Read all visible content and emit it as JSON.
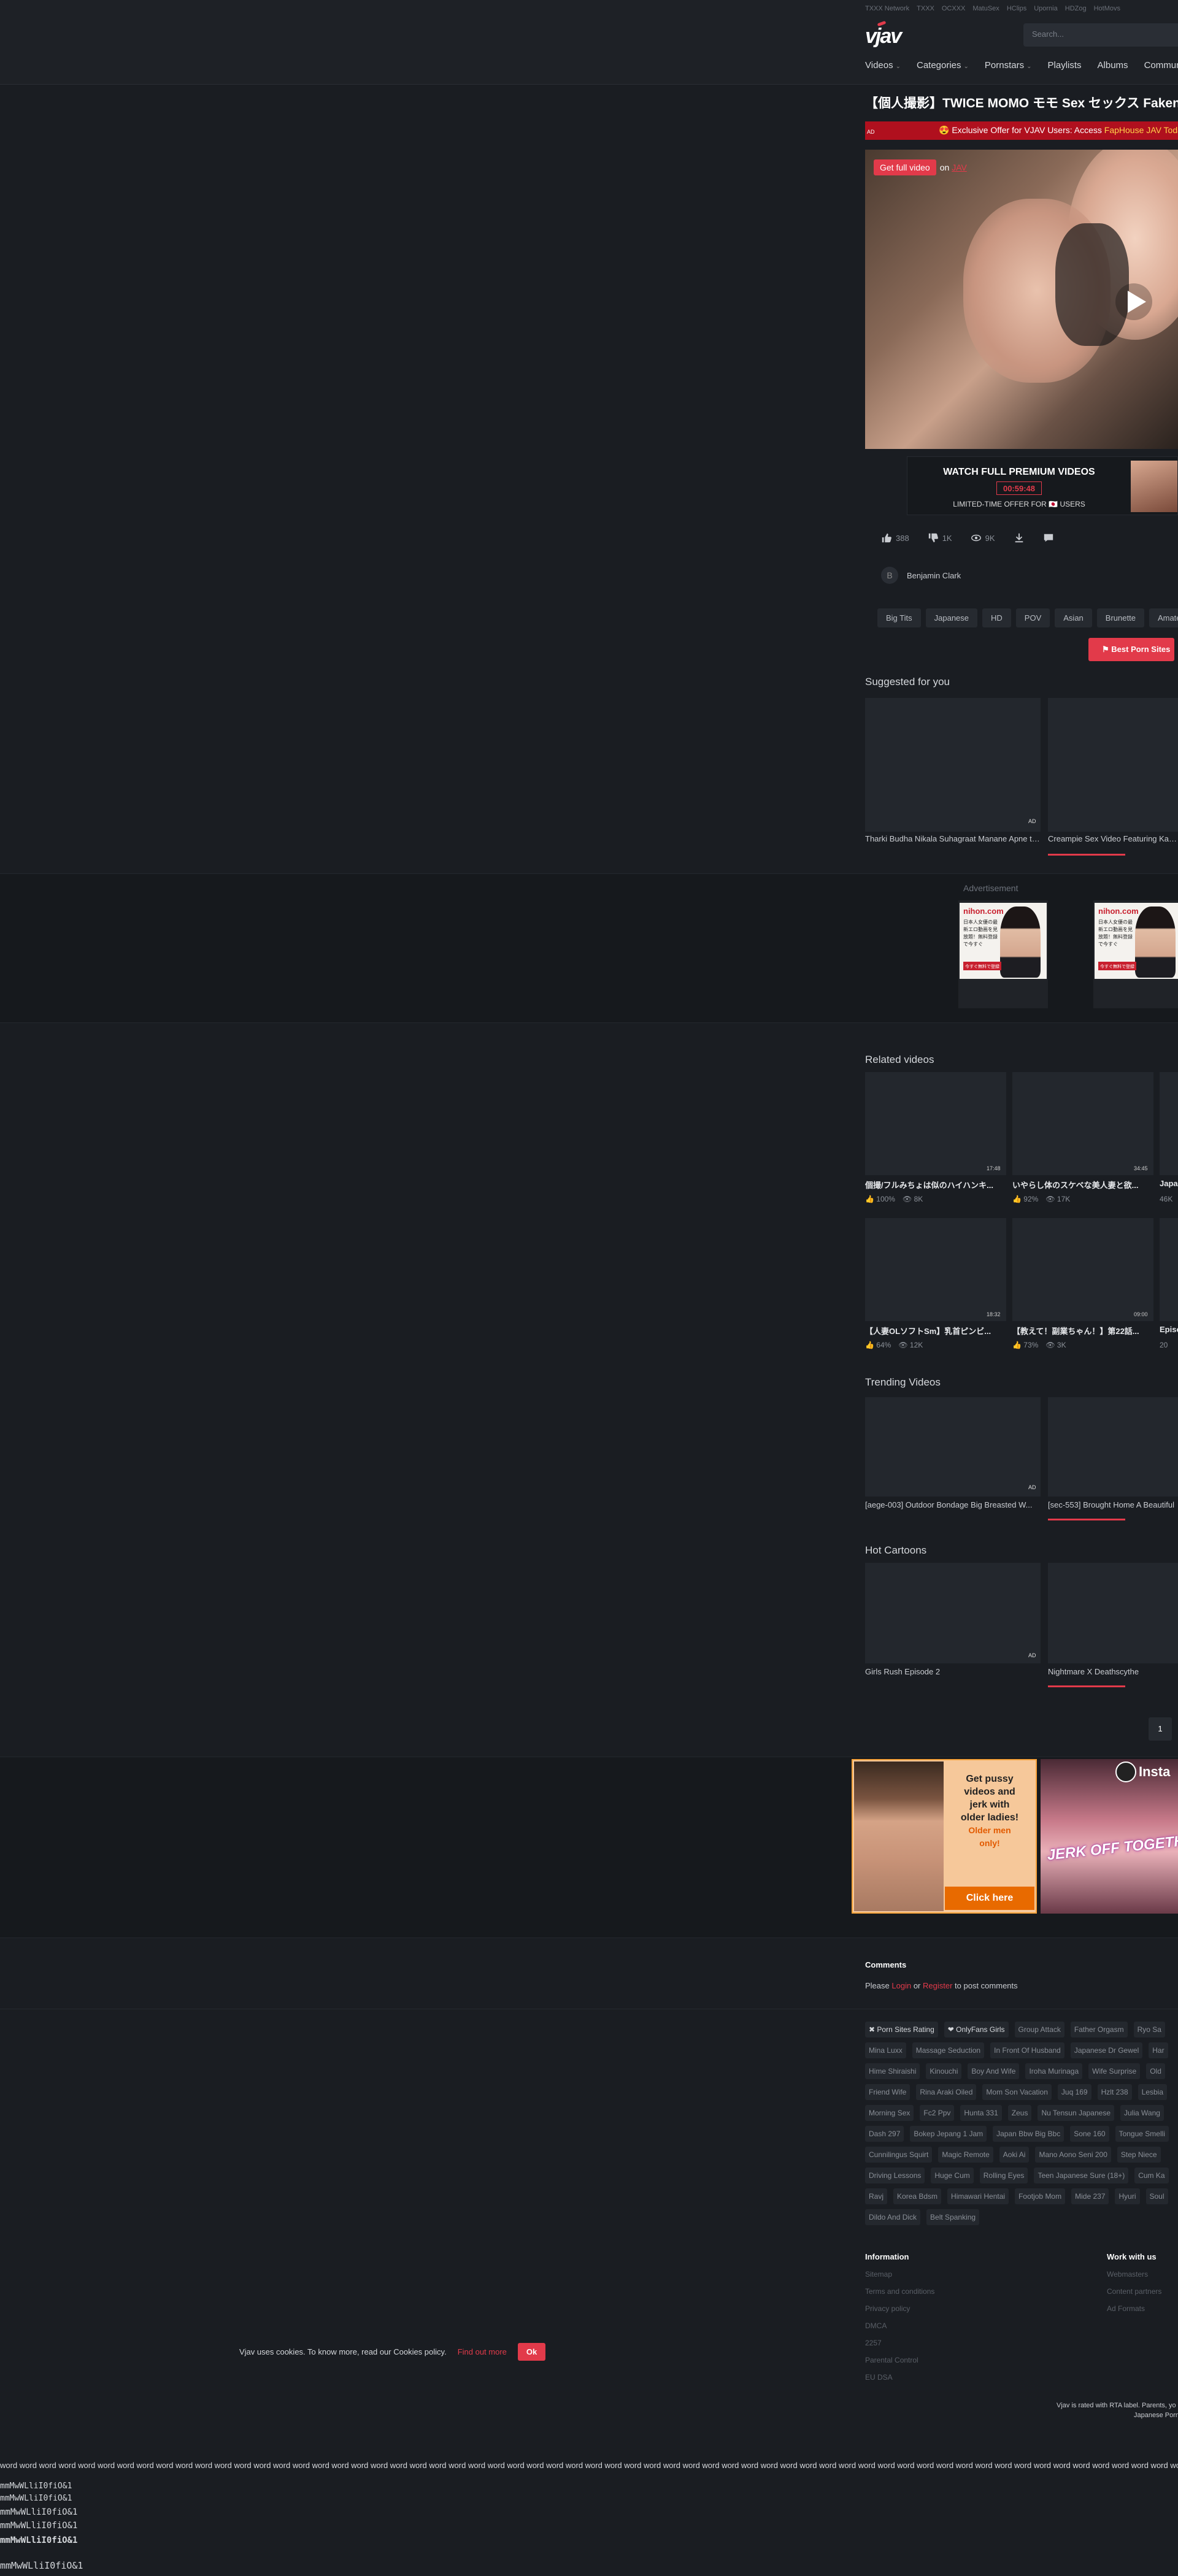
{
  "header": {
    "network_label": "TXXX Network",
    "network_links": [
      "TXXX",
      "OCXXX",
      "MatuSex",
      "HClips",
      "Upornia",
      "HDZog",
      "HotMovs"
    ],
    "logo": "vjav",
    "search_placeholder": "Search...",
    "nav": [
      {
        "label": "Videos",
        "has_dropdown": true
      },
      {
        "label": "Categories",
        "has_dropdown": true
      },
      {
        "label": "Pornstars",
        "has_dropdown": true
      },
      {
        "label": "Playlists",
        "has_dropdown": false
      },
      {
        "label": "Albums",
        "has_dropdown": false
      },
      {
        "label": "Community",
        "has_dropdown": false
      }
    ]
  },
  "video": {
    "title": "【個人撮影】TWICE MOMO モモ Sex セックス Fakenude",
    "ad_label": "AD",
    "offer_text": "😍 Exclusive Offer for VJAV Users: Access ",
    "offer_highlight": "FapHouse JAV Today",
    "get_full_label": "Get full video",
    "get_full_on": "on",
    "get_full_site": "JAV"
  },
  "premium": {
    "headline": "WATCH FULL PREMIUM VIDEOS",
    "timer": "00:59:48",
    "subline": "LIMITED-TIME OFFER FOR 🇯🇵 USERS"
  },
  "stats": {
    "likes": "388",
    "dislikes": "1K",
    "views": "9K"
  },
  "author": {
    "initial": "B",
    "name": "Benjamin Clark"
  },
  "tags": [
    "Big Tits",
    "Japanese",
    "HD",
    "POV",
    "Asian",
    "Brunette",
    "Amateur"
  ],
  "best_sites_button": "Best Porn Sites",
  "suggested": {
    "heading": "Suggested for you",
    "items": [
      {
        "title": "Tharki Budha Nikala Suhagraat Manane Apne te...",
        "badge": "AD"
      },
      {
        "title": "Creampie Sex Video Featuring Kanna"
      }
    ]
  },
  "advertisement_label": "Advertisement",
  "ad_creative": {
    "brand": "nihon.com",
    "text": "日本人女優の最新エロ動画を見放題！無料登録で今すぐ",
    "button": "今すぐ無料で登録"
  },
  "related": {
    "heading": "Related videos",
    "rows": [
      [
        {
          "title": "個撮/フルみちょは似のハイハンキ...",
          "duration": "17:48",
          "rating": "100%",
          "views": "8K"
        },
        {
          "title": "いやらし体のスケベな美人妻と欲...",
          "duration": "34:45",
          "rating": "92%",
          "views": "17K"
        },
        {
          "title": "Japanese",
          "duration": "",
          "rating": "",
          "views": "46K"
        }
      ],
      [
        {
          "title": "【人妻OLソフトSm】乳首ピンビ...",
          "duration": "18:32",
          "rating": "64%",
          "views": "12K"
        },
        {
          "title": "【教えて！副業ちゃん！】第22話...",
          "duration": "09:00",
          "rating": "73%",
          "views": "3K"
        },
        {
          "title": "Episode",
          "duration": "",
          "rating": "",
          "views": "20"
        }
      ]
    ]
  },
  "trending": {
    "heading": "Trending Videos",
    "items": [
      {
        "title": "[aege-003] Outdoor Bondage Big Breasted W...",
        "badge": "AD"
      },
      {
        "title": "[sec-553] Brought Home A Beautiful"
      }
    ]
  },
  "cartoons": {
    "heading": "Hot Cartoons",
    "items": [
      {
        "title": "Girls Rush Episode 2",
        "badge": "AD"
      },
      {
        "title": "Nightmare X Deathscythe"
      }
    ]
  },
  "pagination": {
    "current": "1"
  },
  "banners": {
    "left_copy_lines": [
      "Get pussy",
      "videos and",
      "jerk with",
      "older ladies!"
    ],
    "left_copy_orange": [
      "Older men",
      "only!"
    ],
    "left_cta": "Click here",
    "right_text": "JERK OFF TOGETHER",
    "right_brand": "Insta"
  },
  "comments": {
    "heading": "Comments",
    "prefix": "Please",
    "login": "Login",
    "or": "or",
    "register": "Register",
    "suffix": "to post comments"
  },
  "tag_cloud": [
    {
      "label": "✖ Porn Sites Rating",
      "hl": true
    },
    {
      "label": "❤ OnlyFans Girls",
      "hl": true
    },
    {
      "label": "Group Attack"
    },
    {
      "label": "Father Orgasm"
    },
    {
      "label": "Ryo Sa"
    },
    {
      "label": "Mina Luxx"
    },
    {
      "label": "Massage Seduction"
    },
    {
      "label": "In Front Of Husband"
    },
    {
      "label": "Japanese Dr Gewel"
    },
    {
      "label": "Har"
    },
    {
      "label": "Hime Shiraishi"
    },
    {
      "label": "Kinouchi"
    },
    {
      "label": "Boy And Wife"
    },
    {
      "label": "Iroha Murinaga"
    },
    {
      "label": "Wife Surprise"
    },
    {
      "label": "Old"
    },
    {
      "label": "Friend Wife"
    },
    {
      "label": "Rina Araki Oiled"
    },
    {
      "label": "Mom Son Vacation"
    },
    {
      "label": "Juq 169"
    },
    {
      "label": "Hzlt 238"
    },
    {
      "label": "Lesbia"
    },
    {
      "label": "Morning Sex"
    },
    {
      "label": "Fc2 Ppv"
    },
    {
      "label": "Hunta 331"
    },
    {
      "label": "Zeus"
    },
    {
      "label": "Nu Tensun Japanese"
    },
    {
      "label": "Julia Wang"
    },
    {
      "label": "Dash 297"
    },
    {
      "label": "Bokep Jepang 1 Jam"
    },
    {
      "label": "Japan Bbw Big Bbc"
    },
    {
      "label": "Sone 160"
    },
    {
      "label": "Tongue Smelli"
    },
    {
      "label": "Cunnilingus Squirt"
    },
    {
      "label": "Magic Remote"
    },
    {
      "label": "Aoki Ai"
    },
    {
      "label": "Mano Aono Seni 200"
    },
    {
      "label": "Step Niece"
    },
    {
      "label": "Driving Lessons"
    },
    {
      "label": "Huge Cum"
    },
    {
      "label": "Rolling Eyes"
    },
    {
      "label": "Teen Japanese Sure (18+)"
    },
    {
      "label": "Cum Ka"
    },
    {
      "label": "Ravj"
    },
    {
      "label": "Korea Bdsm"
    },
    {
      "label": "Himawari Hentai"
    },
    {
      "label": "Footjob Mom"
    },
    {
      "label": "Mide 237"
    },
    {
      "label": "Hyuri"
    },
    {
      "label": "Soul"
    },
    {
      "label": "Dildo And Dick"
    },
    {
      "label": "Belt Spanking"
    }
  ],
  "footer": {
    "info_heading": "Information",
    "info_links": [
      "Sitemap",
      "Terms and conditions",
      "Privacy policy",
      "DMCA",
      "2257",
      "Parental Control",
      "EU DSA"
    ],
    "work_heading": "Work with us",
    "work_links": [
      "Webmasters",
      "Content partners",
      "Ad Formats"
    ],
    "rta_line1": "Vjav is rated with RTA label. Parents, yo",
    "rta_line2": "Japanese Porn"
  },
  "cookie": {
    "text": "Vjav uses cookies. To know more, read our Cookies policy.",
    "link": "Find out more",
    "ok": "Ok"
  },
  "debug_text": {
    "words": "word word word word word word word word word word word word word word word word word word word word word word word word word word word word word word word word word word word word word word word word word word word word word word word word word word word word word word word word word word word word word word word word word word word word word word word word word word word word word word word word word word word word word word word word word word word word word word word word word word word word word word",
    "lines": [
      "mmMwWLliI0fiO&1",
      "mmMwWLliI0fiO&1",
      "mmMwWLliI0fiO&1",
      "mmMwWLliI0fiO&1",
      "mmMwWLliI0fiO&1",
      "mmMwWLliI0fiO&1"
    ]
  }
}
